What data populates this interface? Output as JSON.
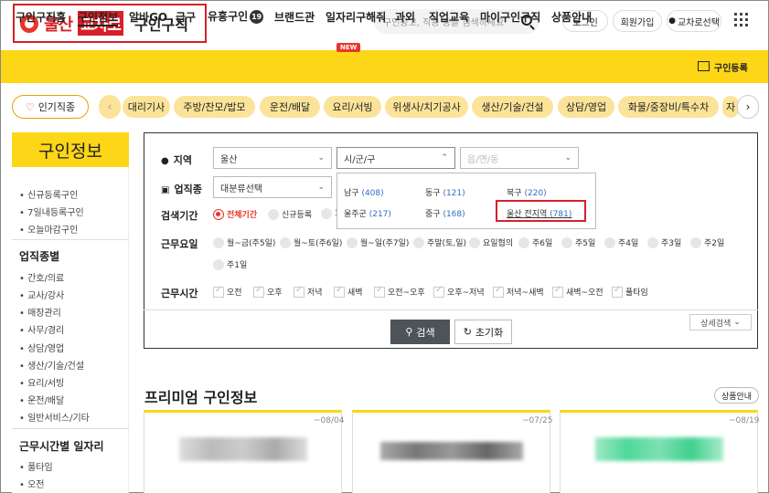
{
  "header": {
    "logo_text": "울산",
    "logo_badge": "교차로",
    "logo_subtitle": "구인구직",
    "search_placeholder": "구인공고, 직종 등을 검색하세요",
    "login": "로그인",
    "signup": "회원가입",
    "region_select": "교차로선택"
  },
  "nav": {
    "items": [
      "구인구직홈",
      "구인정보",
      "알바GO",
      "급구",
      "유흥구인",
      "브랜드관",
      "일자리구해줘",
      "과외",
      "직업교육",
      "마이구인구직",
      "상품안내"
    ],
    "badge_count": "19",
    "new_badge": "NEW",
    "register": "구인등록"
  },
  "keywords": {
    "hot_label": "인기직종",
    "items": [
      "대리기사",
      "주방/찬모/밥모",
      "운전/배달",
      "요리/서빙",
      "위생사/치기공사",
      "생산/기술/건설",
      "상담/영업",
      "화물/중장비/특수차",
      "자"
    ]
  },
  "sidebar": {
    "title": "구인정보",
    "quick": [
      "신규등록구인",
      "7일내등록구인",
      "오늘마감구인"
    ],
    "section1": "업직종별",
    "jobs": [
      "간호/의료",
      "교사/강사",
      "매장관리",
      "사무/경리",
      "상담/영업",
      "생산/기술/건설",
      "요리/서빙",
      "운전/배달",
      "일반서비스/기타"
    ],
    "section2": "근무시간별 일자리",
    "times": [
      "풀타임",
      "오전"
    ]
  },
  "form": {
    "region_label": "지역",
    "region_value": "울산",
    "district_value": "시/군/구",
    "town_value": "읍/면/동",
    "job_label": "업직종",
    "job_value": "대분류선택",
    "period_label": "검색기간",
    "period_options": [
      "전체기간",
      "신규등록"
    ],
    "period_extra": "3",
    "days_label": "근무요일",
    "days": [
      "월~금(주5일)",
      "월~토(주6일)",
      "월~일(주7일)",
      "주말(토,일)",
      "요일협의",
      "주6일",
      "주5일",
      "주4일",
      "주3일",
      "주2일",
      "주1일"
    ],
    "hours_label": "근무시간",
    "hours": [
      "오전",
      "오후",
      "저녁",
      "새벽",
      "오전~오후",
      "오후~저녁",
      "저녁~새벽",
      "새벽~오전",
      "풀타임"
    ],
    "search_button": "검색",
    "reset_button": "초기화",
    "detail_button": "상세검색"
  },
  "district_popup": {
    "items": [
      {
        "name": "남구",
        "count": "(408)"
      },
      {
        "name": "동구",
        "count": "(121)"
      },
      {
        "name": "북구",
        "count": "(220)"
      },
      {
        "name": "울주군",
        "count": "(217)"
      },
      {
        "name": "중구",
        "count": "(168)"
      },
      {
        "name": "울산 전지역",
        "count": "(781)"
      }
    ]
  },
  "premium": {
    "title": "프리미엄 구인정보",
    "guide": "상품안내",
    "cards": [
      {
        "date": "~08/04",
        "accent": "#b9b9b9"
      },
      {
        "date": "~07/25",
        "accent": "#8a8a8a"
      },
      {
        "date": "~08/19",
        "accent": "#5fd9a3"
      }
    ]
  },
  "colors": {
    "brand_yellow": "#fcd617",
    "brand_red": "#d6202a",
    "link_blue": "#2f6ec6"
  }
}
